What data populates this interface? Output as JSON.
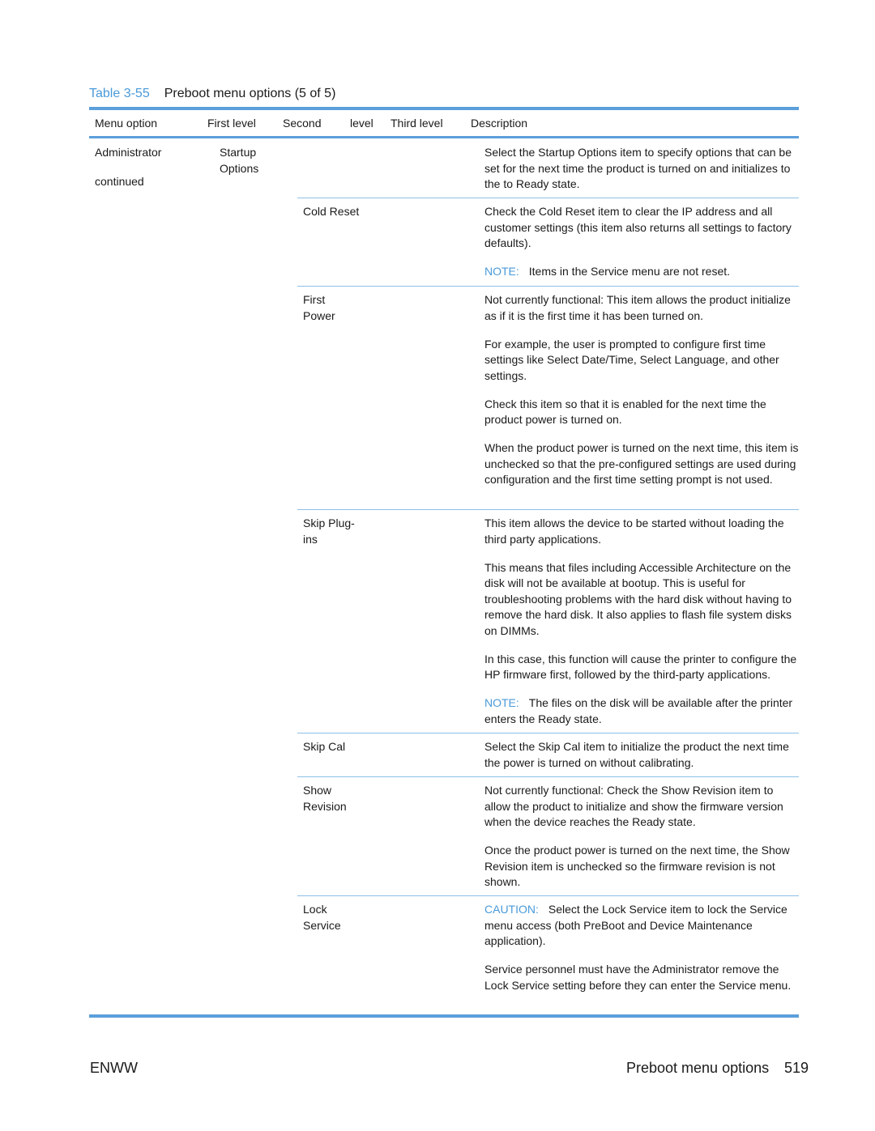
{
  "caption": {
    "number": "Table 3-55",
    "title": "Preboot menu options (5 of 5)"
  },
  "headers": [
    "Menu option",
    "First level",
    "Second",
    "level",
    "Third level",
    "Description"
  ],
  "menu_option": {
    "name": "Administrator",
    "note": "continued"
  },
  "first_level": "Startup Options",
  "rows": [
    {
      "second": "",
      "paragraphs": [
        {
          "text": "Select the Startup Options item to specify options that can be set for the next time the product is turned on and initializes to the to Ready state."
        }
      ]
    },
    {
      "second": "Cold Reset",
      "paragraphs": [
        {
          "text": "Check the Cold Reset item to clear the IP address and all customer settings (this item also returns all settings to factory defaults)."
        },
        {
          "label": "NOTE:",
          "text": "Items in the Service menu are not reset."
        }
      ]
    },
    {
      "second": "First Power",
      "paragraphs": [
        {
          "text": "Not currently functional: This item allows the product initialize as if it is the first time it has been turned on."
        },
        {
          "text": "For example, the user is prompted to configure first time settings like Select Date/Time, Select Language, and other settings."
        },
        {
          "text": "Check this item so that it is enabled for the next time the product power is turned on."
        },
        {
          "text": "When the product power is turned on the next time, this item is unchecked so that the pre-configured settings are used during configuration and the first time setting prompt is not used."
        }
      ]
    },
    {
      "second": "Skip Plug-ins",
      "paragraphs": [
        {
          "text": "This item allows the device to be started without loading the third party applications."
        },
        {
          "text": "This means that files including Accessible Architecture on the disk will not be available at bootup. This is useful for troubleshooting problems with the hard disk without having to remove the hard disk. It also applies to flash file system disks on DIMMs."
        },
        {
          "text": "In this case, this function will cause the printer to configure the HP firmware first, followed by the third-party applications."
        },
        {
          "label": "NOTE:",
          "text": "The files on the disk will be available after the printer enters the Ready state."
        }
      ]
    },
    {
      "second": "Skip Cal",
      "paragraphs": [
        {
          "text": "Select the Skip Cal item to initialize the product the next time the power is turned on without calibrating."
        }
      ]
    },
    {
      "second": "Show Revision",
      "paragraphs": [
        {
          "text": "Not currently functional: Check the Show Revision item to allow the product to initialize and show the firmware version when the device reaches the Ready state."
        },
        {
          "text": "Once the product power is turned on the next time, the Show Revision item is unchecked so the firmware revision is not shown."
        }
      ]
    },
    {
      "second": "Lock Service",
      "paragraphs": [
        {
          "label": "CAUTION:",
          "text": "Select the Lock Service item to lock the Service menu access (both PreBoot and Device Maintenance application)."
        },
        {
          "text": "Service personnel must have the Administrator remove the Lock Service setting before they can enter the Service menu."
        }
      ]
    }
  ],
  "footer": {
    "left": "ENWW",
    "section": "Preboot menu options",
    "page": "519"
  }
}
